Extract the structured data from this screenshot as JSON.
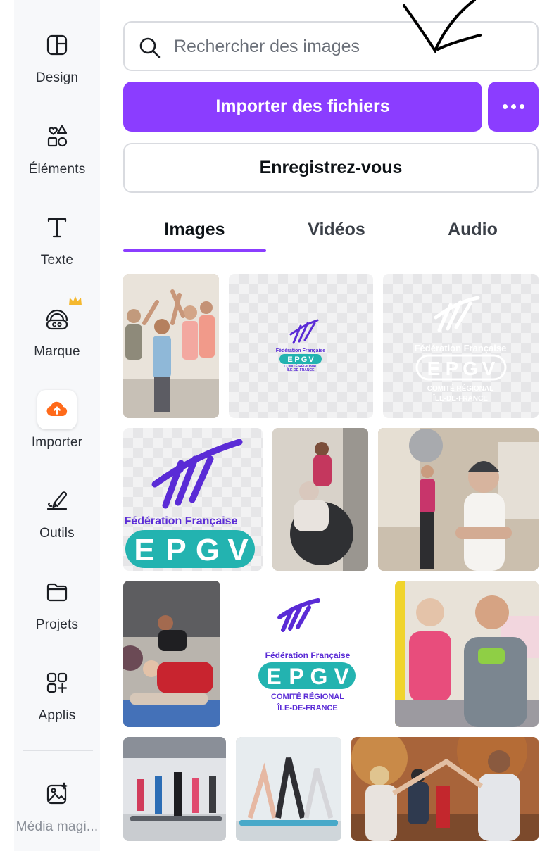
{
  "sidebar": {
    "items": [
      {
        "label": "Design",
        "icon": "layout-icon"
      },
      {
        "label": "Éléments",
        "icon": "shapes-icon"
      },
      {
        "label": "Texte",
        "icon": "text-icon"
      },
      {
        "label": "Marque",
        "icon": "brand-icon"
      },
      {
        "label": "Importer",
        "icon": "upload-cloud-icon"
      },
      {
        "label": "Outils",
        "icon": "draw-tools-icon"
      },
      {
        "label": "Projets",
        "icon": "folder-icon"
      },
      {
        "label": "Applis",
        "icon": "apps-icon"
      },
      {
        "label": "Média magi...",
        "icon": "magic-media-icon"
      }
    ]
  },
  "search": {
    "placeholder": "Rechercher des images"
  },
  "actions": {
    "import_label": "Importer des fichiers",
    "register_label": "Enregistrez-vous"
  },
  "tabs": [
    {
      "label": "Images",
      "active": true
    },
    {
      "label": "Vidéos",
      "active": false
    },
    {
      "label": "Audio",
      "active": false
    }
  ],
  "logo": {
    "federation": "Fédération Française",
    "letters": [
      "E",
      "P",
      "G",
      "V"
    ],
    "committee": "COMITÉ RÉGIONAL",
    "region": "ÎLE-DE-FRANCE"
  },
  "colors": {
    "accent": "#8b3dff",
    "upload_orange": "#ff6a1a",
    "logo_purple": "#5a2bd6",
    "logo_teal": "#23b3b0",
    "crown": "#f5b82e"
  }
}
